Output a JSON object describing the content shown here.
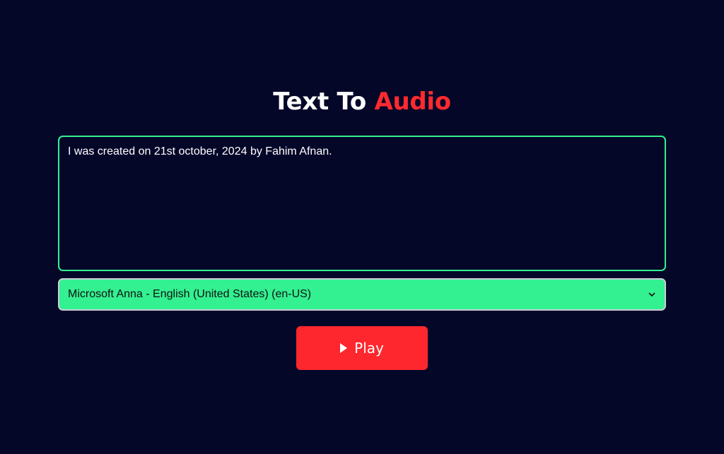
{
  "header": {
    "title_prefix": "Text To",
    "title_accent": "Audio"
  },
  "text_input": {
    "value": "I was created on 21st october, 2024 by Fahim Afnan."
  },
  "voice_select": {
    "selected": "Microsoft Anna - English (United States) (en-US)"
  },
  "play_button": {
    "label": "Play",
    "icon": "play-icon"
  },
  "colors": {
    "background": "#050729",
    "accent_red": "#ff272e",
    "accent_green": "#33f090",
    "text": "#ffffff"
  }
}
